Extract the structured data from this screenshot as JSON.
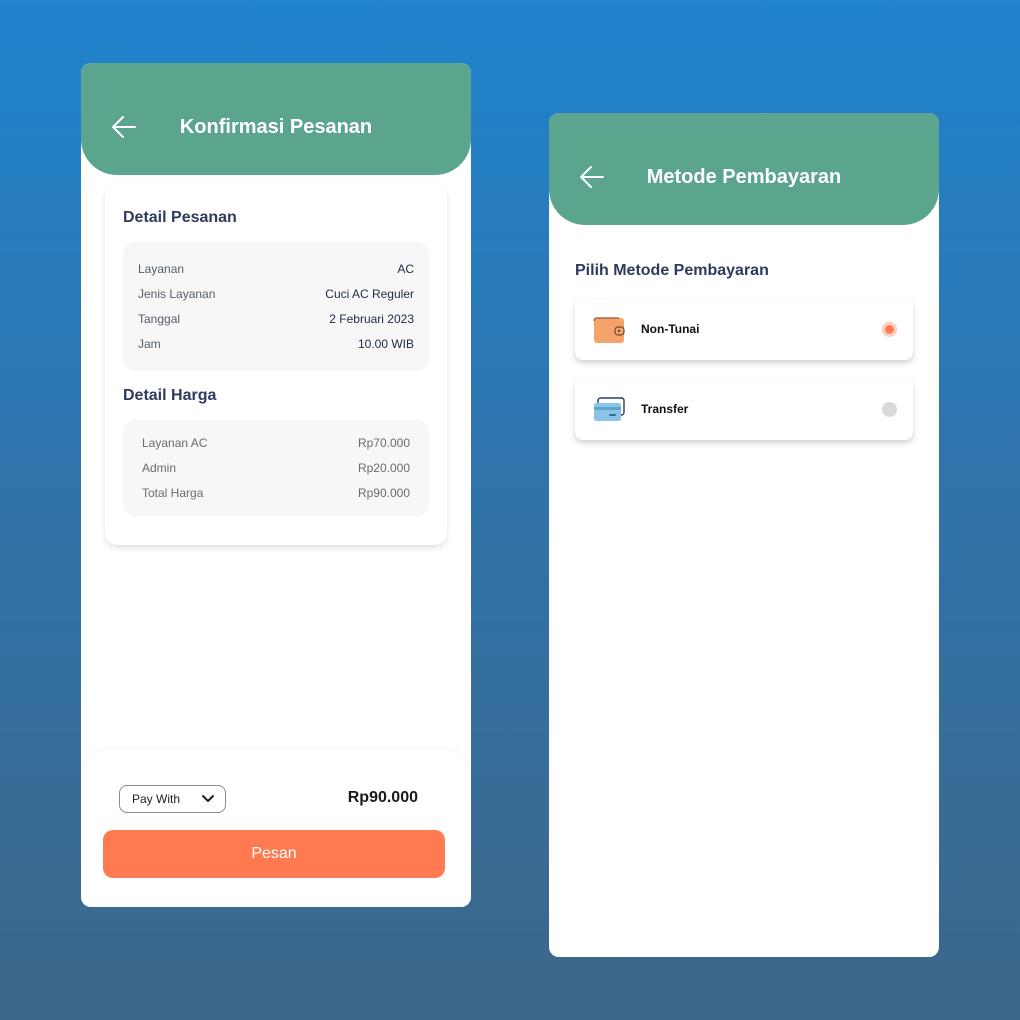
{
  "confirm_screen": {
    "title": "Konfirmasi Pesanan",
    "order_detail": {
      "title": "Detail Pesanan",
      "rows": [
        {
          "label": "Layanan",
          "value": "AC"
        },
        {
          "label": "Jenis Layanan",
          "value": "Cuci AC Reguler"
        },
        {
          "label": "Tanggal",
          "value": "2 Februari 2023"
        },
        {
          "label": "Jam",
          "value": "10.00 WIB"
        }
      ]
    },
    "price_detail": {
      "title": "Detail Harga",
      "rows": [
        {
          "label": "Layanan AC",
          "value": "Rp70.000"
        },
        {
          "label": "Admin",
          "value": "Rp20.000"
        },
        {
          "label": "Total Harga",
          "value": "Rp90.000"
        }
      ]
    },
    "bottom": {
      "pay_with_label": "Pay With",
      "total": "Rp90.000",
      "order_button": "Pesan"
    }
  },
  "payment_screen": {
    "title": "Metode Pembayaran",
    "subtitle": "Pilih Metode Pembayaran",
    "options": [
      {
        "label": "Non-Tunai",
        "icon": "wallet-icon",
        "selected": true
      },
      {
        "label": "Transfer",
        "icon": "card-icon",
        "selected": false
      }
    ]
  },
  "colors": {
    "header": "#5ba48e",
    "accent": "#ff7a50",
    "heading_text": "#2f3a5f",
    "background_top": "#1f83cd",
    "background_bottom": "#3d6789"
  }
}
